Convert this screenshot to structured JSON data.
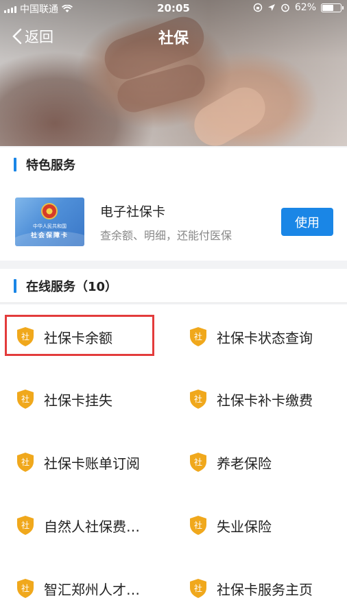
{
  "status_bar": {
    "carrier": "中国联通",
    "time": "20:05",
    "battery_level_percent": 62,
    "battery": "62%"
  },
  "nav": {
    "back_label": "返回",
    "title": "社保"
  },
  "featured": {
    "section_title": "特色服务",
    "card_line1": "中华人民共和国",
    "card_line2": "社会保障卡",
    "title": "电子社保卡",
    "subtitle": "查余额、明细，还能付医保",
    "button_label": "使用"
  },
  "online": {
    "section_title": "在线服务（10）",
    "services": [
      {
        "label": "社保卡余额",
        "icon": "社"
      },
      {
        "label": "社保卡状态查询",
        "icon": "社"
      },
      {
        "label": "社保卡挂失",
        "icon": "社"
      },
      {
        "label": "社保卡补卡缴费",
        "icon": "社"
      },
      {
        "label": "社保卡账单订阅",
        "icon": "社"
      },
      {
        "label": "养老保险",
        "icon": "社"
      },
      {
        "label": "自然人社保费…",
        "icon": "社"
      },
      {
        "label": "失业保险",
        "icon": "社"
      },
      {
        "label": "智汇郑州人才…",
        "icon": "社"
      },
      {
        "label": "社保卡服务主页",
        "icon": "社"
      }
    ]
  },
  "colors": {
    "accent": "#1a86e6",
    "shield": "#f0a81c",
    "highlight": "#e33b3b"
  }
}
